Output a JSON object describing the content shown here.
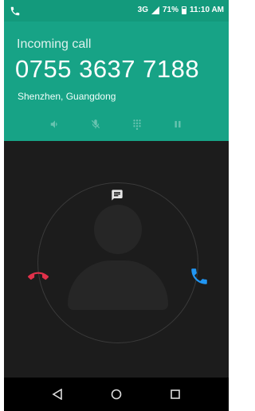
{
  "status_bar": {
    "network": "3G",
    "battery": "71%",
    "time": "11:10 AM"
  },
  "call": {
    "label": "Incoming call",
    "number": "0755 3637 7188",
    "location": "Shenzhen, Guangdong"
  },
  "controls": [
    "speaker-icon",
    "mute-icon",
    "dialpad-icon",
    "hold-icon"
  ],
  "actions": {
    "message": "message-icon",
    "decline": "decline-icon",
    "answer": "answer-icon"
  },
  "nav": [
    "back-icon",
    "home-icon",
    "recents-icon"
  ],
  "colors": {
    "header": "#17a386",
    "status_bar": "#139a7c",
    "decline": "#e0314a",
    "answer": "#2196f3",
    "background": "#1c1c1c"
  }
}
